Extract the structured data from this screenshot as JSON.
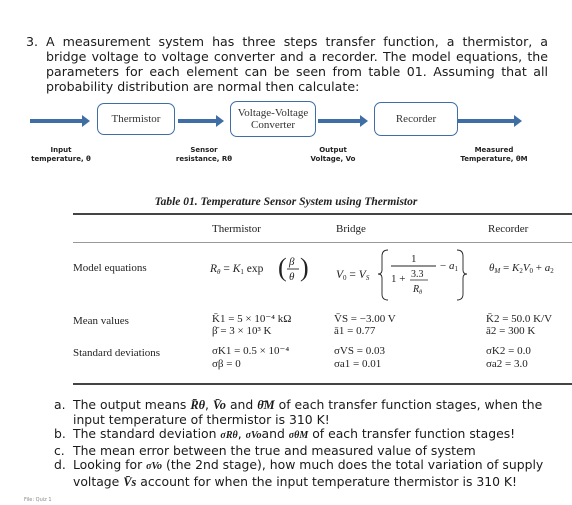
{
  "question": {
    "number": "3.",
    "text": "A measurement system has three steps transfer function, a thermistor, a bridge voltage to voltage converter and a recorder. The model equations, the parameters for each element can be seen from table 01. Assuming that all probability distribution are normal then calculate:"
  },
  "diagram": {
    "blocks": [
      {
        "label": "Thermistor"
      },
      {
        "label_line1": "Voltage-Voltage",
        "label_line2": "Converter"
      },
      {
        "label": "Recorder"
      }
    ],
    "signals": [
      {
        "line1": "Input",
        "line2": "temperature, θ"
      },
      {
        "line1": "Sensor",
        "line2": "resistance, Rθ"
      },
      {
        "line1": "Output",
        "line2": "Voltage, Vo"
      },
      {
        "line1": "Measured",
        "line2": "Temperature, θM"
      }
    ],
    "arrow_color": "#3f6ea5"
  },
  "table": {
    "caption": "Table 01. Temperature Sensor System using Thermistor",
    "headers": [
      "",
      "Thermistor",
      "Bridge",
      "Recorder"
    ],
    "rows": [
      {
        "label": "Model equations",
        "thermistor": "Rθ = K1 exp(β/θ)",
        "bridge": "V0 = VS {1/(1 + 3.3/Rθ) − a1}",
        "recorder": "θM = K2V0 + a2"
      },
      {
        "label": "Mean values",
        "thermistor": [
          "K̄1 = 5 × 10⁻⁴ kΩ",
          "β̄ = 3 × 10³ K"
        ],
        "bridge": [
          "V̄S = −3.00 V",
          "ā1 = 0.77"
        ],
        "recorder": [
          "K̄2 = 50.0 K/V",
          "ā2 = 300 K"
        ]
      },
      {
        "label": "Standard deviations",
        "thermistor": [
          "σK1 = 0.5 × 10⁻⁴",
          "σβ = 0"
        ],
        "bridge": [
          "σVS = 0.03",
          "σa1 = 0.01"
        ],
        "recorder": [
          "σK2 = 0.0",
          "σa2 = 3.0"
        ]
      }
    ],
    "eq_parts": {
      "exp": "exp",
      "beta": "β",
      "theta": "θ",
      "one": "1",
      "plus": "1 +",
      "three_three": "3.3",
      "minus_a1": "− a",
      "equals": "="
    }
  },
  "tasks": [
    {
      "label": "a.",
      "pre": "The output means ",
      "s1": "R̄θ",
      "m1": ", ",
      "s2": "V̄o",
      "m2": " and ",
      "s3": "θ̄M",
      "post": " of each transfer function stages, when the input temperature of thermistor is 310 K!"
    },
    {
      "label": "b.",
      "pre": "The standard deviation ",
      "s1": "σRθ",
      "m1": ", ",
      "s2": "σVo",
      "m2": "and ",
      "s3": "σθM",
      "post": " of each transfer function stages!"
    },
    {
      "label": "c.",
      "text": "The mean error between the true and measured value of system"
    },
    {
      "label": "d.",
      "pre": "Looking for ",
      "s1": "σVo",
      "m1": " (the 2nd stage), how much does the total variation of supply voltage ",
      "s2": "V̄s",
      "post": " account for when the input temperature thermistor is 310 K!"
    }
  ],
  "footer": "File: Quiz 1"
}
